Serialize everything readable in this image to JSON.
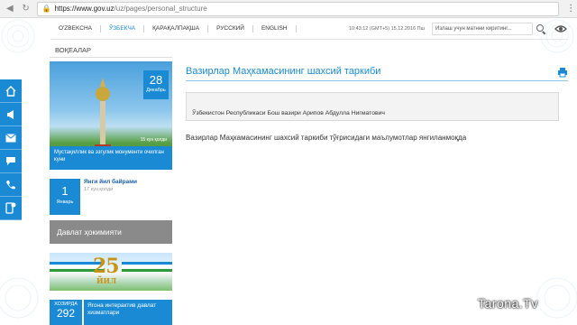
{
  "browser": {
    "url_host": "https://www.gov.uz",
    "url_path": "/uz/pages/personal_structure"
  },
  "topbar": {
    "languages": [
      {
        "label": "O'ZBEKCHA"
      },
      {
        "label": "ЎЗБЕКЧА"
      },
      {
        "label": "ҚАРАҚАЛПАҚША"
      },
      {
        "label": "РУССКИЙ"
      },
      {
        "label": "ENGLISH"
      }
    ],
    "datetime": "10:43:12 (GMT+5)   15.12.2016 Пш",
    "search_placeholder": "Излаш учун матнни киритинг...",
    "accent_color": "#1a8ad4"
  },
  "sidebar": {
    "icons": [
      "home-icon",
      "megaphone-icon",
      "mail-icon",
      "chat-icon",
      "phone-icon",
      "mobile-app-icon"
    ]
  },
  "left": {
    "section_title": "ВОҚЕАЛАР",
    "news1": {
      "day": "28",
      "month": "Декабрь",
      "ago": "15 кун қолди",
      "caption": "Мустақиллик ва эзгулик монументи очилган куни"
    },
    "news2": {
      "day": "1",
      "month": "Январь",
      "title": "Янги йил байрами",
      "ago": "17 кун қолди"
    },
    "gray_bar": "Давлат ҳокимияти",
    "banner": {
      "number": "25",
      "word": "ЙИЛ"
    },
    "bottom_box": {
      "label": "ХОЗИРДА",
      "number": "292",
      "text": "Ягона интерактив давлат хизматлари"
    }
  },
  "main": {
    "title": "Вазирлар Маҳкамасининг шахсий таркиби",
    "info_box": "Ўзбекистон Республикаси Бош вазири Арипов Абдулла Нигматович",
    "content": "Вазирлар Маҳкамасининг шахсий таркиби тўғрисидаги маълумотлар янгиланмоқда"
  },
  "watermark": "Tarona.Tv"
}
